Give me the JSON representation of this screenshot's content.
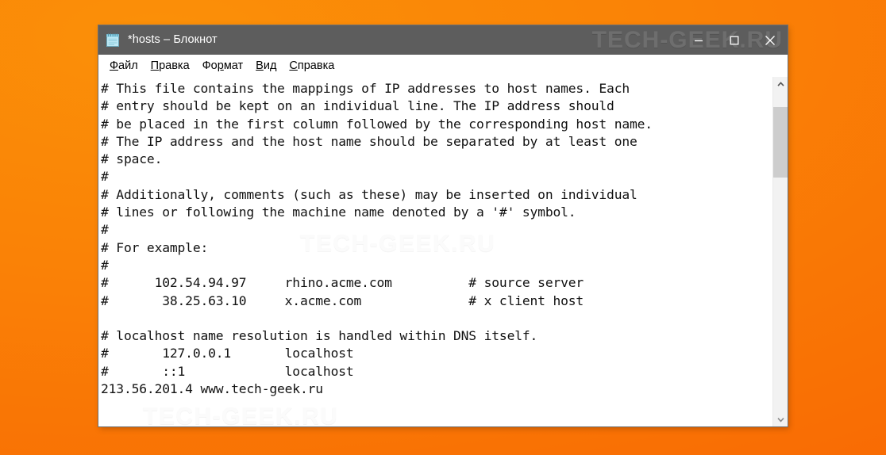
{
  "desktop": {
    "background_color_top_left": "#fa8c08",
    "background_color_bottom_right": "#f96a03"
  },
  "window": {
    "title": "*hosts – Блокнот",
    "icon": "notepad-icon",
    "titlebar_color": "#5d5d5d",
    "controls": {
      "minimize_label": "—",
      "maximize_label": "□",
      "close_label": "×"
    },
    "watermark": "TECH-GEEK.RU"
  },
  "menu": {
    "items": [
      {
        "id": "file",
        "pre": "",
        "accel": "Ф",
        "post": "айл"
      },
      {
        "id": "edit",
        "pre": "",
        "accel": "П",
        "post": "равка"
      },
      {
        "id": "format",
        "pre": "Фо",
        "accel": "р",
        "post": "мат"
      },
      {
        "id": "view",
        "pre": "",
        "accel": "В",
        "post": "ид"
      },
      {
        "id": "help",
        "pre": "",
        "accel": "С",
        "post": "правка"
      }
    ]
  },
  "editor": {
    "watermark_mid": "TECH-GEEK.RU",
    "watermark_low": "TECH-GEEK.RU",
    "lines": [
      "# This file contains the mappings of IP addresses to host names. Each",
      "# entry should be kept on an individual line. The IP address should",
      "# be placed in the first column followed by the corresponding host name.",
      "# The IP address and the host name should be separated by at least one",
      "# space.",
      "#",
      "# Additionally, comments (such as these) may be inserted on individual",
      "# lines or following the machine name denoted by a '#' symbol.",
      "#",
      "# For example:",
      "#",
      "#      102.54.94.97     rhino.acme.com          # source server",
      "#       38.25.63.10     x.acme.com              # x client host",
      "",
      "# localhost name resolution is handled within DNS itself.",
      "#       127.0.0.1       localhost",
      "#       ::1             localhost",
      "213.56.201.4 www.tech-geek.ru"
    ]
  },
  "scrollbar": {
    "up_arrow": "▲",
    "down_arrow": "▼",
    "thumb_position_percent": 5,
    "thumb_size_percent": 22
  }
}
